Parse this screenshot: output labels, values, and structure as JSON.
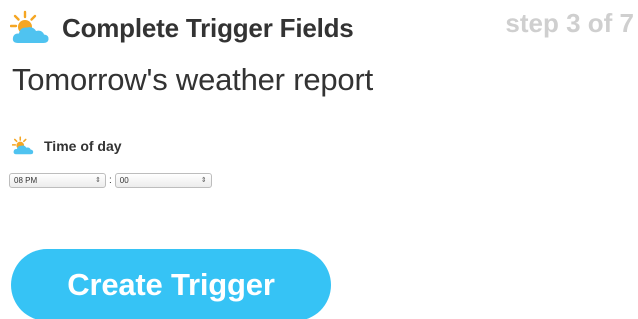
{
  "header": {
    "icon": "weather-partly-sunny-icon",
    "title": "Complete Trigger Fields",
    "step": "step 3 of 7"
  },
  "trigger": {
    "name": "Tomorrow's weather report"
  },
  "time_field": {
    "icon": "weather-partly-sunny-icon",
    "label": "Time of day",
    "hour_value": "08 PM",
    "separator": ":",
    "minute_value": "00",
    "select_arrow": "⇕"
  },
  "actions": {
    "create_label": "Create Trigger"
  },
  "colors": {
    "accent": "#36c3f5",
    "text": "#333333",
    "muted": "#cfcfcf",
    "sun": "#f5a623",
    "cloud": "#4fc3f0"
  }
}
